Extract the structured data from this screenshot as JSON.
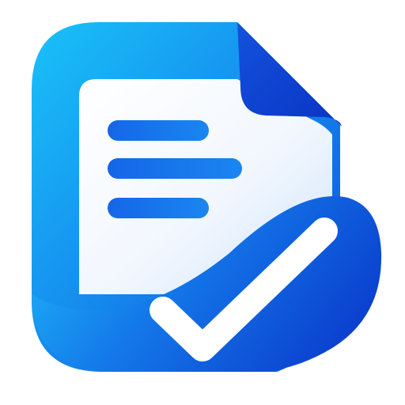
{
  "icon": {
    "name": "document-check-icon",
    "parts": [
      "document-icon",
      "text-lines",
      "checkmark-icon"
    ]
  },
  "colors": {
    "background": "#ffffff",
    "frame_light": "#17b6f6",
    "frame_mid": "#1683ea",
    "frame_dark": "#0c42d6",
    "fold": "#0f3fd4",
    "paper": "#f3f7fd",
    "paper_shadow": "#cfe3fb",
    "text_lines": "#1377ee",
    "wave_light": "#1ba6f5",
    "wave_dark": "#0a3fcf",
    "checkmark": "#ffffff"
  }
}
